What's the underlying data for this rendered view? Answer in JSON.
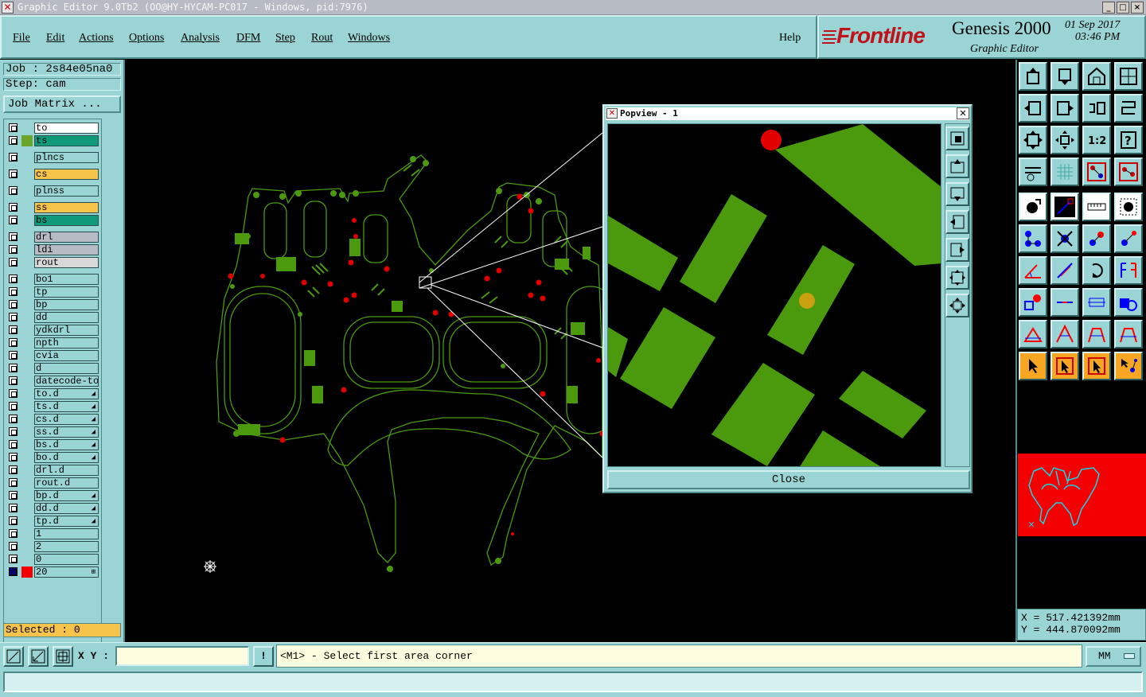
{
  "window": {
    "title": "Graphic Editor 9.0Tb2 (OO@HY-HYCAM-PC017 - Windows, pid:7976)",
    "controls": [
      "_",
      "□",
      "×"
    ]
  },
  "menu": {
    "items": [
      "File",
      "Edit",
      "Actions",
      "Options",
      "Analysis",
      "DFM",
      "Step",
      "Rout",
      "Windows"
    ],
    "help": "Help"
  },
  "brand": {
    "logo": "Frontline",
    "product": "Genesis 2000",
    "subtitle": "Graphic Editor",
    "date": "01 Sep 2017",
    "time": "03:46 PM"
  },
  "job": {
    "job_label": "Job : 2s84e05na0",
    "step_label": "Step: cam",
    "matrix_button": "Job Matrix ..."
  },
  "layers": [
    {
      "name": "to",
      "bg": "#ffffff",
      "swatch": ""
    },
    {
      "name": "ts",
      "bg": "#119a7a",
      "swatch": "#6aa52a"
    },
    {
      "name": "plncs",
      "bg": "#9ad4d4",
      "swatch": ""
    },
    {
      "name": "cs",
      "bg": "#f6c34b",
      "swatch": ""
    },
    {
      "name": "plnss",
      "bg": "#9ad4d4",
      "swatch": ""
    },
    {
      "name": "ss",
      "bg": "#f6c34b",
      "swatch": ""
    },
    {
      "name": "bs",
      "bg": "#119a7a",
      "swatch": ""
    },
    {
      "name": "drl",
      "bg": "#b7bcc4",
      "swatch": ""
    },
    {
      "name": "ldi",
      "bg": "#b7bcc4",
      "swatch": ""
    },
    {
      "name": "rout",
      "bg": "#d8d8d8",
      "swatch": ""
    },
    {
      "name": "bo1",
      "bg": "#9ad4d4",
      "swatch": ""
    },
    {
      "name": "tp",
      "bg": "#9ad4d4",
      "swatch": ""
    },
    {
      "name": "bp",
      "bg": "#9ad4d4",
      "swatch": ""
    },
    {
      "name": "dd",
      "bg": "#9ad4d4",
      "swatch": ""
    },
    {
      "name": "ydkdrl",
      "bg": "#9ad4d4",
      "swatch": ""
    },
    {
      "name": "npth",
      "bg": "#9ad4d4",
      "swatch": ""
    },
    {
      "name": "cvia",
      "bg": "#9ad4d4",
      "swatch": ""
    },
    {
      "name": "d",
      "bg": "#9ad4d4",
      "swatch": ""
    },
    {
      "name": "datecode-to",
      "bg": "#9ad4d4",
      "swatch": ""
    },
    {
      "name": "to.d",
      "bg": "#9ad4d4",
      "swatch": "",
      "mark": true
    },
    {
      "name": "ts.d",
      "bg": "#9ad4d4",
      "swatch": "",
      "mark": true
    },
    {
      "name": "cs.d",
      "bg": "#9ad4d4",
      "swatch": "",
      "mark": true
    },
    {
      "name": "ss.d",
      "bg": "#9ad4d4",
      "swatch": "",
      "mark": true
    },
    {
      "name": "bs.d",
      "bg": "#9ad4d4",
      "swatch": "",
      "mark": true
    },
    {
      "name": "bo.d",
      "bg": "#9ad4d4",
      "swatch": "",
      "mark": true
    },
    {
      "name": "drl.d",
      "bg": "#9ad4d4",
      "swatch": ""
    },
    {
      "name": "rout.d",
      "bg": "#9ad4d4",
      "swatch": ""
    },
    {
      "name": "bp.d",
      "bg": "#9ad4d4",
      "swatch": "",
      "mark": true
    },
    {
      "name": "dd.d",
      "bg": "#9ad4d4",
      "swatch": "",
      "mark": true
    },
    {
      "name": "tp.d",
      "bg": "#9ad4d4",
      "swatch": "",
      "mark": true
    },
    {
      "name": "1",
      "bg": "#9ad4d4",
      "swatch": ""
    },
    {
      "name": "2",
      "bg": "#9ad4d4",
      "swatch": ""
    },
    {
      "name": "0",
      "bg": "#9ad4d4",
      "swatch": ""
    },
    {
      "name": "20",
      "bg": "#9ad4d4",
      "swatch": "#f40000",
      "mark": true
    }
  ],
  "selected": "Selected : 0",
  "popview": {
    "title": "Popview - 1",
    "close_button": "Close"
  },
  "coords": {
    "x": "X = 517.421392mm",
    "y": "Y = 444.870092mm"
  },
  "statusbar": {
    "xy_label": "X Y :",
    "xy_value": "",
    "info_button": "!",
    "message": "<M1> - Select first area corner",
    "units": "MM"
  },
  "colors": {
    "panel": "#9ad4d4",
    "copper": "#4b9a0e",
    "pad_red": "#e00000",
    "outline": "#4b9a0e",
    "orange": "#f6a623"
  },
  "icons": {
    "toolbar_rows": [
      [
        "board-up-icon",
        "board-down-icon",
        "home-icon",
        "panel-split-icon"
      ],
      [
        "arrow-left-icon",
        "arrow-right-icon",
        "swap-icon",
        "flip-icon"
      ],
      [
        "fit-height-icon",
        "fit-center-icon",
        "scale-1-2-icon",
        "help-icon"
      ],
      [
        "settings-icon",
        "grid-icon",
        "layer-stack-icon",
        "layer-stack-alt-icon"
      ],
      [
        "add-feature-icon",
        "draw-line-icon",
        "measure-icon",
        "select-pad-icon"
      ],
      [
        "connect-nodes-icon",
        "delete-node-icon",
        "move-node-icon",
        "split-node-icon"
      ],
      [
        "angle-icon",
        "diagonal-icon",
        "rotate-icon",
        "mirror-icon"
      ],
      [
        "pad-square-icon",
        "line-cut-icon",
        "dimension-icon",
        "pad-group-icon"
      ],
      [
        "shape-tri-icon",
        "shape-arc-icon",
        "shape-a-icon",
        "shape-a2-icon"
      ],
      [
        "pointer-icon",
        "pointer-box-icon",
        "pointer-select-icon",
        "pointer-net-icon"
      ]
    ]
  }
}
